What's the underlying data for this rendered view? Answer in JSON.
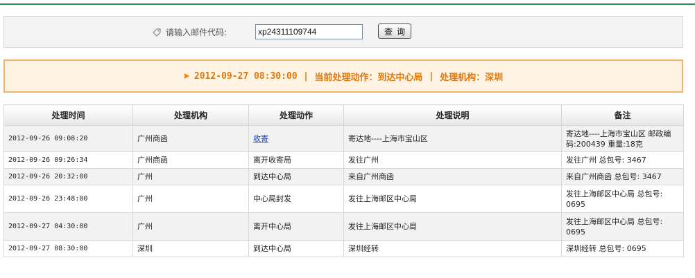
{
  "search": {
    "label": "请输入邮件代码:",
    "value": "xp24311109744",
    "button_label": "查询"
  },
  "status": {
    "datetime": "2012-09-27 08:30:00",
    "action": "当前处理动作：到达中心局",
    "agency": "处理机构：深圳",
    "color": "#e2780a"
  },
  "table": {
    "headers": [
      "处理时间",
      "处理机构",
      "处理动作",
      "处理说明",
      "备注"
    ],
    "rows": [
      {
        "time": "2012-09-26 09:08:20",
        "agency": "广州商函",
        "action": "收寄",
        "desc": "寄达地----上海市宝山区",
        "note": "寄达地----上海市宝山区 邮政编码:200439 重量:18克"
      },
      {
        "time": "2012-09-26 09:26:34",
        "agency": "广州商函",
        "action": "离开收寄局",
        "desc": "发往广州",
        "note": "发往广州 总包号: 3467"
      },
      {
        "time": "2012-09-26 20:32:00",
        "agency": "广州",
        "action": "到达中心局",
        "desc": "来自广州商函",
        "note": "来自广州商函 总包号: 3467"
      },
      {
        "time": "2012-09-26 23:48:00",
        "agency": "广州",
        "action": "中心局封发",
        "desc": "发往上海邮区中心局",
        "note": "发往上海邮区中心局 总包号: 0695"
      },
      {
        "time": "2012-09-27 04:30:00",
        "agency": "广州",
        "action": "离开中心局",
        "desc": "发往上海邮区中心局",
        "note": "发往上海邮区中心局 总包号: 0695"
      },
      {
        "time": "2012-09-27 08:30:00",
        "agency": "深圳",
        "action": "到达中心局",
        "desc": "深圳经转",
        "note": "深圳经转 总包号: 0695"
      }
    ]
  }
}
